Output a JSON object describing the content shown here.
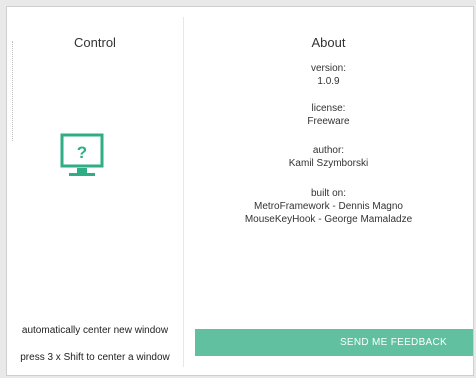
{
  "control": {
    "title": "Control",
    "icon": "monitor-question-icon",
    "accent": "#2fae86",
    "option1": "automatically center new window",
    "option2": "press 3 x Shift to center a window"
  },
  "about": {
    "title": "About",
    "version_label": "version:",
    "version_value": "1.0.9",
    "license_label": "license:",
    "license_value": "Freeware",
    "author_label": "author:",
    "author_value": "Kamil Szymborski",
    "built_label": "built on:",
    "built_lines": [
      "MetroFramework - Dennis Magno",
      "MouseKeyHook - George Mamaladze"
    ]
  },
  "feedback": {
    "label": "SEND ME FEEDBACK",
    "color": "#61c09f"
  }
}
